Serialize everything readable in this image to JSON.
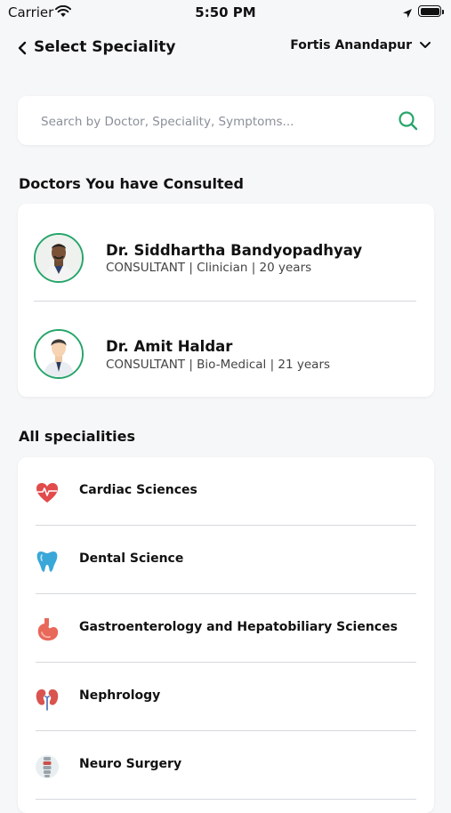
{
  "status_bar": {
    "carrier": "Carrier",
    "time": "5:50 PM"
  },
  "header": {
    "title": "Select Speciality",
    "branch": "Fortis Anandapur"
  },
  "search": {
    "placeholder": "Search by Doctor, Speciality, Symptoms..."
  },
  "consulted": {
    "title": "Doctors You have Consulted",
    "doctors": [
      {
        "name": "Dr. Siddhartha Bandyopadhyay",
        "meta": "CONSULTANT | Clinician | 20 years"
      },
      {
        "name": "Dr. Amit Haldar",
        "meta": "CONSULTANT | Bio-Medical | 21 years"
      }
    ]
  },
  "specialities": {
    "title": "All specialities",
    "items": [
      {
        "label": "Cardiac Sciences",
        "icon": "heart-icon"
      },
      {
        "label": "Dental Science",
        "icon": "tooth-icon"
      },
      {
        "label": "Gastroenterology and Hepatobiliary Sciences",
        "icon": "stomach-icon"
      },
      {
        "label": "Nephrology",
        "icon": "kidney-icon"
      },
      {
        "label": "Neuro Surgery",
        "icon": "spine-icon"
      }
    ]
  },
  "colors": {
    "accent": "#27a56a",
    "background": "#f6f7f9",
    "card": "#ffffff"
  }
}
